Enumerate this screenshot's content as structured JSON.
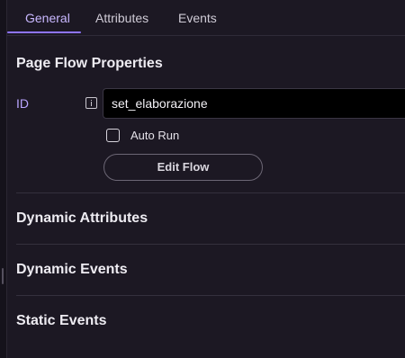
{
  "tabs": [
    {
      "label": "General",
      "active": true
    },
    {
      "label": "Attributes",
      "active": false
    },
    {
      "label": "Events",
      "active": false
    }
  ],
  "page_flow": {
    "title": "Page Flow Properties",
    "id_label": "ID",
    "id_value": "set_elaborazione",
    "auto_run_label": "Auto Run",
    "auto_run_checked": false,
    "edit_flow_label": "Edit Flow"
  },
  "sections": [
    {
      "title": "Dynamic Attributes"
    },
    {
      "title": "Dynamic Events"
    },
    {
      "title": "Static Events"
    }
  ],
  "colors": {
    "accent": "#8e74ff",
    "background": "#1c1823",
    "input_background": "#000000"
  }
}
